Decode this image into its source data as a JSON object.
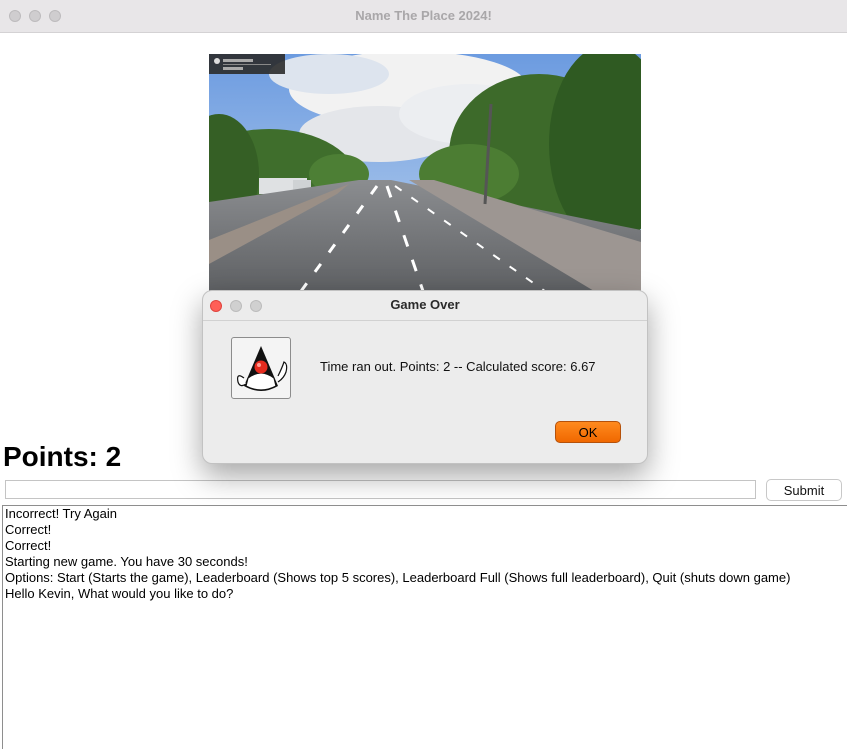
{
  "window": {
    "title": "Name The Place 2024!"
  },
  "game": {
    "points_label": "Points: 2",
    "answer_value": "",
    "submit_label": "Submit"
  },
  "log": {
    "lines": [
      "Incorrect! Try Again",
      "Correct!",
      "Correct!",
      "Starting new game. You have 30 seconds!",
      "Options: Start (Starts the game), Leaderboard (Shows top 5 scores), Leaderboard Full (Shows full leaderboard), Quit (shuts down game)",
      "Hello Kevin, What would you like to do?"
    ]
  },
  "dialog": {
    "title": "Game Over",
    "message": "Time ran out. Points: 2 -- Calculated score: 6.67",
    "ok_label": "OK",
    "icon": "java-duke-icon"
  },
  "colors": {
    "ok_button": "#f06800",
    "close_red": "#ff5f57"
  }
}
